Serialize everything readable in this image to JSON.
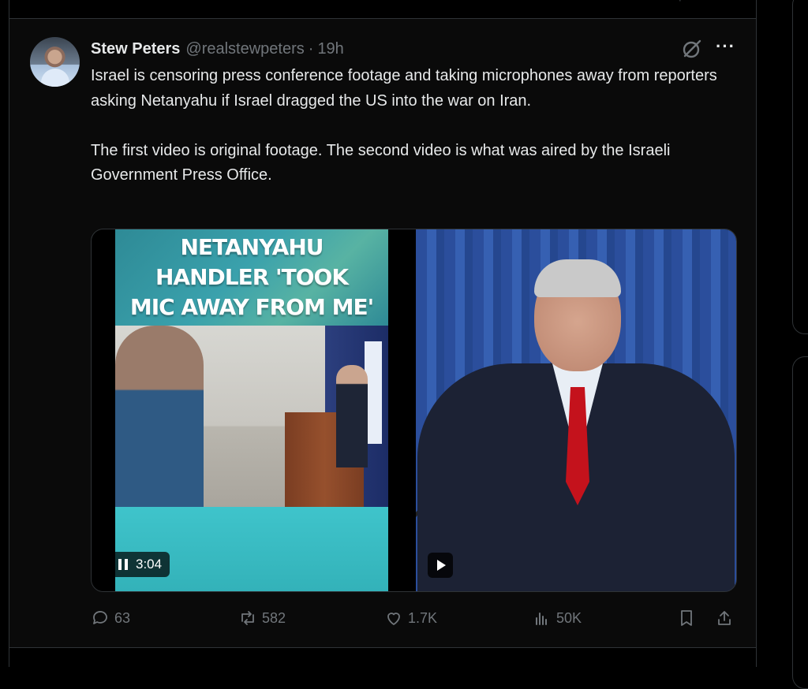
{
  "tweet": {
    "author_name": "Stew Peters",
    "handle": "@realstewpeters",
    "separator": "·",
    "time": "19h",
    "text_p1": "Israel is censoring press conference footage and taking microphones away from reporters asking Netanyahu if Israel dragged the US into the war on Iran.",
    "text_p2": "The first video is original footage. The second video is what was aired by the Israeli Government Press Office."
  },
  "media": {
    "video1_overlay_title": "NETANYAHU\nHANDLER 'TOOK\nMIC AWAY FROM ME'",
    "video1_duration": "3:04"
  },
  "actions": {
    "replies": "63",
    "reposts": "582",
    "likes": "1.7K",
    "views": "50K"
  },
  "icons": [
    "grok-icon",
    "more-icon",
    "pause-icon",
    "play-icon",
    "reply-icon",
    "repost-icon",
    "like-icon",
    "views-icon",
    "bookmark-icon",
    "share-icon"
  ],
  "colors": {
    "background": "#000000",
    "text": "#e7e9ea",
    "muted": "#71767b",
    "border": "#2f3336"
  }
}
